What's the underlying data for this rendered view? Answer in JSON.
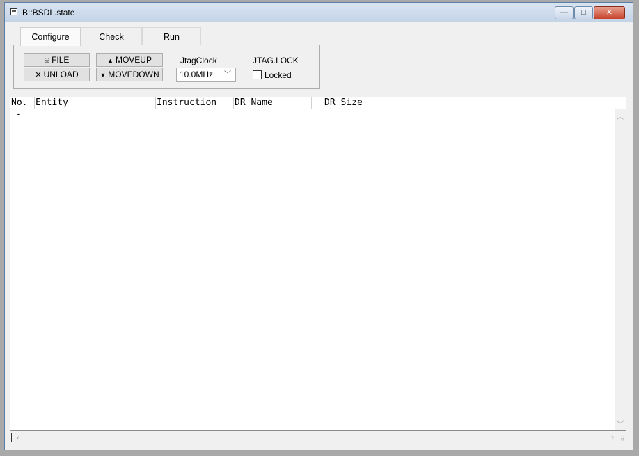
{
  "window": {
    "title": "B::BSDL.state",
    "minimize": "—",
    "maximize": "□",
    "close": "✕"
  },
  "tabs": [
    "Configure",
    "Check",
    "Run"
  ],
  "configure": {
    "file_label": "FILE",
    "unload_label": "UNLOAD",
    "moveup_label": "MOVEUP",
    "movedown_label": "MOVEDOWN",
    "jtagclock_label": "JtagClock",
    "jtagclock_value": "10.0MHz",
    "jtaglock_label": "JTAG.LOCK",
    "locked_label": "Locked",
    "locked_checked": false
  },
  "table": {
    "columns": [
      "No.",
      "Entity",
      "Instruction",
      "DR Name",
      "DR Size"
    ],
    "rows": [
      [
        "-",
        "",
        "",
        "",
        ""
      ]
    ]
  }
}
